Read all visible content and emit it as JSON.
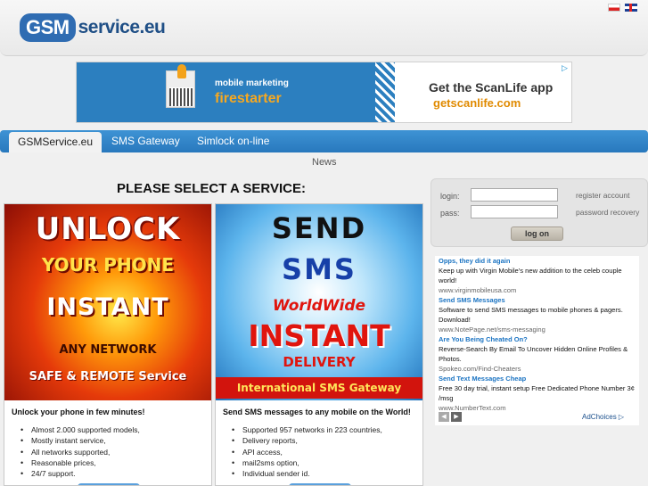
{
  "header": {
    "logo_gsm": "GSM",
    "logo_service": "service.eu"
  },
  "banner": {
    "left_line1": "mobile marketing",
    "left_line2": "firestarter",
    "right_line1": "Get the ScanLife app",
    "right_line2": "getscanlife.com"
  },
  "nav": {
    "tabs": [
      "GSMService.eu",
      "SMS Gateway",
      "Simlock on-line"
    ],
    "sub": "News"
  },
  "main": {
    "title": "PLEASE SELECT A SERVICE:"
  },
  "unlock": {
    "img_lines": [
      "UNLOCK",
      "YOUR PHONE",
      "INSTANT",
      "ANY NETWORK",
      "SAFE & REMOTE Service"
    ],
    "heading": "Unlock your phone in few minutes!",
    "features": [
      "Almost 2.000 supported models,",
      "Mostly instant service,",
      "All networks supported,",
      "Reasonable prices,",
      "24/7 support."
    ]
  },
  "sms": {
    "img_lines": [
      "SEND",
      "SMS",
      "WorldWide",
      "INSTANT",
      "DELIVERY",
      "International SMS Gateway"
    ],
    "heading": "Send SMS messages to any mobile on the World!",
    "features": [
      "Supported 957 networks in 223 countries,",
      "Delivery reports,",
      "API access,",
      "mail2sms option,",
      "Individual sender id."
    ]
  },
  "login": {
    "login_label": "login:",
    "pass_label": "pass:",
    "register": "register account",
    "recovery": "password recovery",
    "logon": "log on"
  },
  "ads": [
    {
      "title": "Opps, they did it again",
      "text": "Keep up with Virgin Mobile's new addition to the celeb couple world!",
      "url": "www.virginmobileusa.com"
    },
    {
      "title": "Send SMS Messages",
      "text": "Software to send SMS messages to mobile phones & pagers. Download!",
      "url": "www.NotePage.net/sms-messaging"
    },
    {
      "title": "Are You Being Cheated On?",
      "text": "Reverse-Search By Email To Uncover Hidden Online Profiles & Photos.",
      "url": "Spokeo.com/Find-Cheaters"
    },
    {
      "title": "Send Text Messages Cheap",
      "text": "Free 30 day trial, instant setup Free Dedicated Phone Number 3¢ /msg",
      "url": "www.NumberText.com"
    }
  ],
  "adchoices": "AdChoices ▷",
  "colors": {
    "nav_blue": "#2f83c8",
    "link_blue": "#1a73c2",
    "brand_blue": "#2f6cb2"
  }
}
